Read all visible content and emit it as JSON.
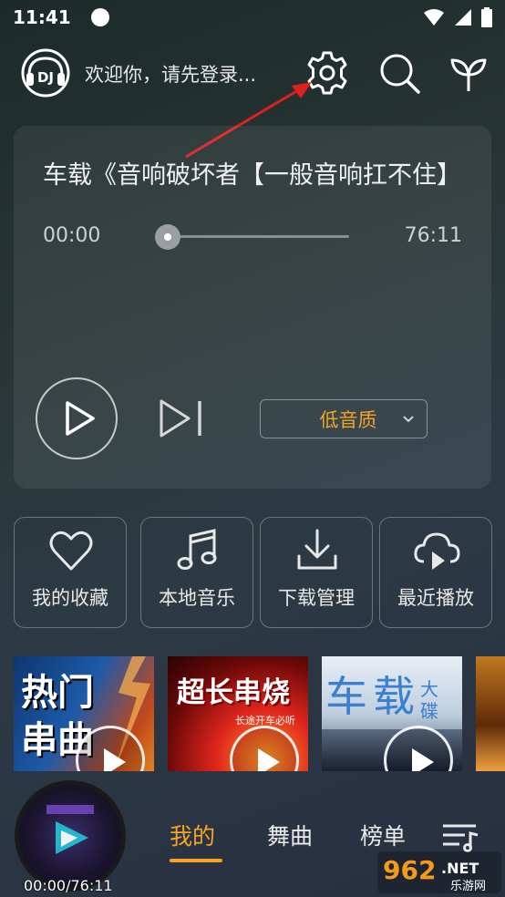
{
  "status_bar": {
    "time": "11:41"
  },
  "header": {
    "welcome_text": "欢迎你，请先登录..."
  },
  "player": {
    "track_title": "车载《音响破坏者【一般音响扛不住】",
    "current_time": "00:00",
    "total_time": "76:11",
    "progress": 0,
    "quality_label": "低音质"
  },
  "shortcuts": [
    {
      "label": "我的收藏",
      "icon": "heart-icon"
    },
    {
      "label": "本地音乐",
      "icon": "music-note-icon"
    },
    {
      "label": "下载管理",
      "icon": "download-icon"
    },
    {
      "label": "最近播放",
      "icon": "cloud-play-icon"
    }
  ],
  "banners": [
    {
      "text": "热门串曲"
    },
    {
      "text": "超长串烧",
      "subtext": "长途开车必听"
    },
    {
      "text": "车载",
      "subtext": "大碟"
    }
  ],
  "bottom": {
    "disc_time": "00:00/76:11",
    "tabs": [
      {
        "label": "我的"
      },
      {
        "label": "舞曲"
      },
      {
        "label": "榜单"
      }
    ]
  },
  "watermark": {
    "main": "962",
    "suffix": ".NET",
    "sub": "乐游网"
  },
  "colors": {
    "accent": "#f5a524",
    "arrow": "#e02020"
  }
}
